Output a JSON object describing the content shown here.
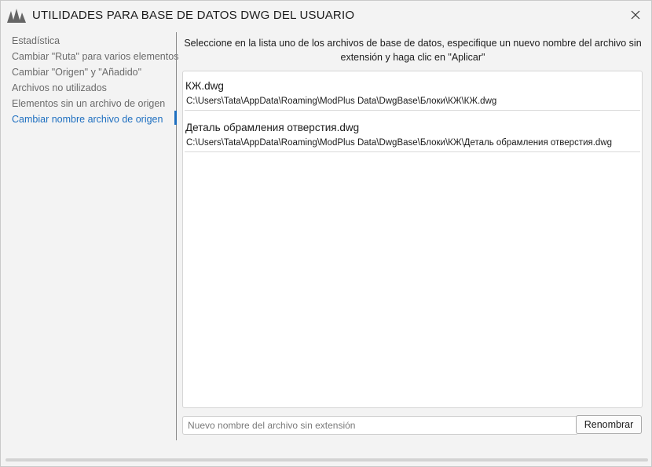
{
  "window": {
    "title": "UTILIDADES PARA BASE DE DATOS DWG DEL USUARIO"
  },
  "nav": {
    "items": [
      {
        "label": "Estadística"
      },
      {
        "label": "Cambiar \"Ruta\" para varios elementos"
      },
      {
        "label": "Cambiar \"Origen\" y \"Añadido\""
      },
      {
        "label": "Archivos no utilizados"
      },
      {
        "label": "Elementos sin un archivo de origen"
      },
      {
        "label": "Cambiar nombre archivo de origen",
        "active": true
      }
    ]
  },
  "main": {
    "instructions": "Seleccione en la lista uno de los archivos de base de datos, especifique un nuevo nombre del archivo sin extensión y haga clic en \"Aplicar\"",
    "files": [
      {
        "name": "КЖ.dwg",
        "path": "C:\\Users\\Tata\\AppData\\Roaming\\ModPlus Data\\DwgBase\\Блоки\\КЖ\\КЖ.dwg"
      },
      {
        "name": "Деталь обрамления отверстия.dwg",
        "path": "C:\\Users\\Tata\\AppData\\Roaming\\ModPlus Data\\DwgBase\\Блоки\\КЖ\\Деталь обрамления отверстия.dwg"
      }
    ],
    "new_name_placeholder": "Nuevo nombre del archivo sin extensión",
    "new_name_value": "",
    "rename_label": "Renombrar"
  },
  "progress": {
    "value": 0
  },
  "colors": {
    "accent": "#1e6fc0",
    "nav_text": "#6b6b6b",
    "background": "#f3f3f3"
  },
  "icons": {
    "logo": "modplus-logo-icon",
    "close": "close-icon"
  }
}
